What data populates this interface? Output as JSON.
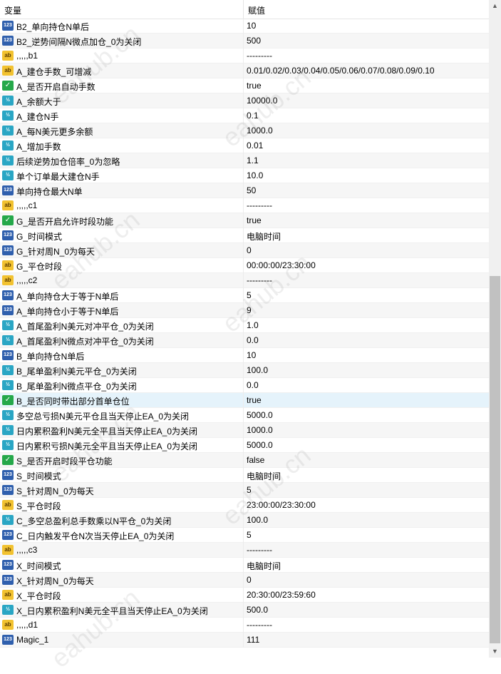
{
  "header": {
    "col_name": "变量",
    "col_value": "赋值"
  },
  "rows": [
    {
      "icon": "integer-icon",
      "name": "B2_单向持仓N单后",
      "value": "10"
    },
    {
      "icon": "integer-icon",
      "name": "B2_逆势间隔N微点加仓_0为关闭",
      "value": "500"
    },
    {
      "icon": "string-icon",
      "name": ",,,,,b1",
      "value": "---------"
    },
    {
      "icon": "string-icon",
      "name": "A_建仓手数_可增减",
      "value": "0.01/0.02/0.03/0.04/0.05/0.06/0.07/0.08/0.09/0.10"
    },
    {
      "icon": "boolean-icon",
      "name": "A_是否开启自动手数",
      "value": "true"
    },
    {
      "icon": "double-icon",
      "name": "A_余额大于",
      "value": "10000.0"
    },
    {
      "icon": "double-icon",
      "name": "A_建仓N手",
      "value": "0.1"
    },
    {
      "icon": "double-icon",
      "name": "A_每N美元更多余额",
      "value": "1000.0"
    },
    {
      "icon": "double-icon",
      "name": "A_增加手数",
      "value": "0.01"
    },
    {
      "icon": "double-icon",
      "name": "后续逆势加仓倍率_0为忽略",
      "value": "1.1"
    },
    {
      "icon": "double-icon",
      "name": "单个订单最大建仓N手",
      "value": "10.0"
    },
    {
      "icon": "integer-icon",
      "name": "单向持仓最大N单",
      "value": "50"
    },
    {
      "icon": "string-icon",
      "name": ",,,,,c1",
      "value": "---------"
    },
    {
      "icon": "boolean-icon",
      "name": "G_是否开启允许时段功能",
      "value": "true"
    },
    {
      "icon": "integer-icon",
      "name": "G_时间模式",
      "value": "电脑时间"
    },
    {
      "icon": "integer-icon",
      "name": "G_针对周N_0为每天",
      "value": "0"
    },
    {
      "icon": "string-icon",
      "name": "G_平仓时段",
      "value": "00:00:00/23:30:00"
    },
    {
      "icon": "string-icon",
      "name": ",,,,,c2",
      "value": "---------"
    },
    {
      "icon": "integer-icon",
      "name": "A_单向持仓大于等于N单后",
      "value": "5"
    },
    {
      "icon": "integer-icon",
      "name": "A_单向持仓小于等于N单后",
      "value": "9"
    },
    {
      "icon": "double-icon",
      "name": "A_首尾盈利N美元对冲平仓_0为关闭",
      "value": "1.0"
    },
    {
      "icon": "double-icon",
      "name": "A_首尾盈利N微点对冲平仓_0为关闭",
      "value": "0.0"
    },
    {
      "icon": "integer-icon",
      "name": "B_单向持仓N单后",
      "value": "10"
    },
    {
      "icon": "double-icon",
      "name": "B_尾单盈利N美元平仓_0为关闭",
      "value": "100.0"
    },
    {
      "icon": "double-icon",
      "name": "B_尾单盈利N微点平仓_0为关闭",
      "value": "0.0"
    },
    {
      "icon": "boolean-icon",
      "name": "B_是否同时带出部分首单仓位",
      "value": "true",
      "selected": true
    },
    {
      "icon": "double-icon",
      "name": "多空总亏损N美元平仓且当天停止EA_0为关闭",
      "value": "5000.0"
    },
    {
      "icon": "double-icon",
      "name": "日内累积盈利N美元全平且当天停止EA_0为关闭",
      "value": "1000.0"
    },
    {
      "icon": "double-icon",
      "name": "日内累积亏损N美元全平且当天停止EA_0为关闭",
      "value": "5000.0"
    },
    {
      "icon": "boolean-icon",
      "name": "S_是否开启时段平仓功能",
      "value": "false"
    },
    {
      "icon": "integer-icon",
      "name": "S_时间模式",
      "value": "电脑时间"
    },
    {
      "icon": "integer-icon",
      "name": "S_针对周N_0为每天",
      "value": "5"
    },
    {
      "icon": "string-icon",
      "name": "S_平仓时段",
      "value": "23:00:00/23:30:00"
    },
    {
      "icon": "double-icon",
      "name": "C_多空总盈利总手数乘以N平仓_0为关闭",
      "value": "100.0"
    },
    {
      "icon": "integer-icon",
      "name": "C_日内触发平仓N次当天停止EA_0为关闭",
      "value": "5"
    },
    {
      "icon": "string-icon",
      "name": ",,,,,c3",
      "value": "---------"
    },
    {
      "icon": "integer-icon",
      "name": "X_时间模式",
      "value": "电脑时间"
    },
    {
      "icon": "integer-icon",
      "name": "X_针对周N_0为每天",
      "value": "0"
    },
    {
      "icon": "string-icon",
      "name": "X_平仓时段",
      "value": "20:30:00/23:59:60"
    },
    {
      "icon": "double-icon",
      "name": "X_日内累积盈利N美元全平且当天停止EA_0为关闭",
      "value": "500.0"
    },
    {
      "icon": "string-icon",
      "name": ",,,,,d1",
      "value": "---------"
    },
    {
      "icon": "integer-icon",
      "name": "Magic_1",
      "value": "111"
    }
  ],
  "icon_glyphs": {
    "integer-icon": "123",
    "string-icon": "ab",
    "boolean-icon": "✓",
    "double-icon": "½"
  },
  "watermark": "eahub.cn",
  "scrollbar": {
    "up_glyph": "▲",
    "down_glyph": "▼"
  }
}
